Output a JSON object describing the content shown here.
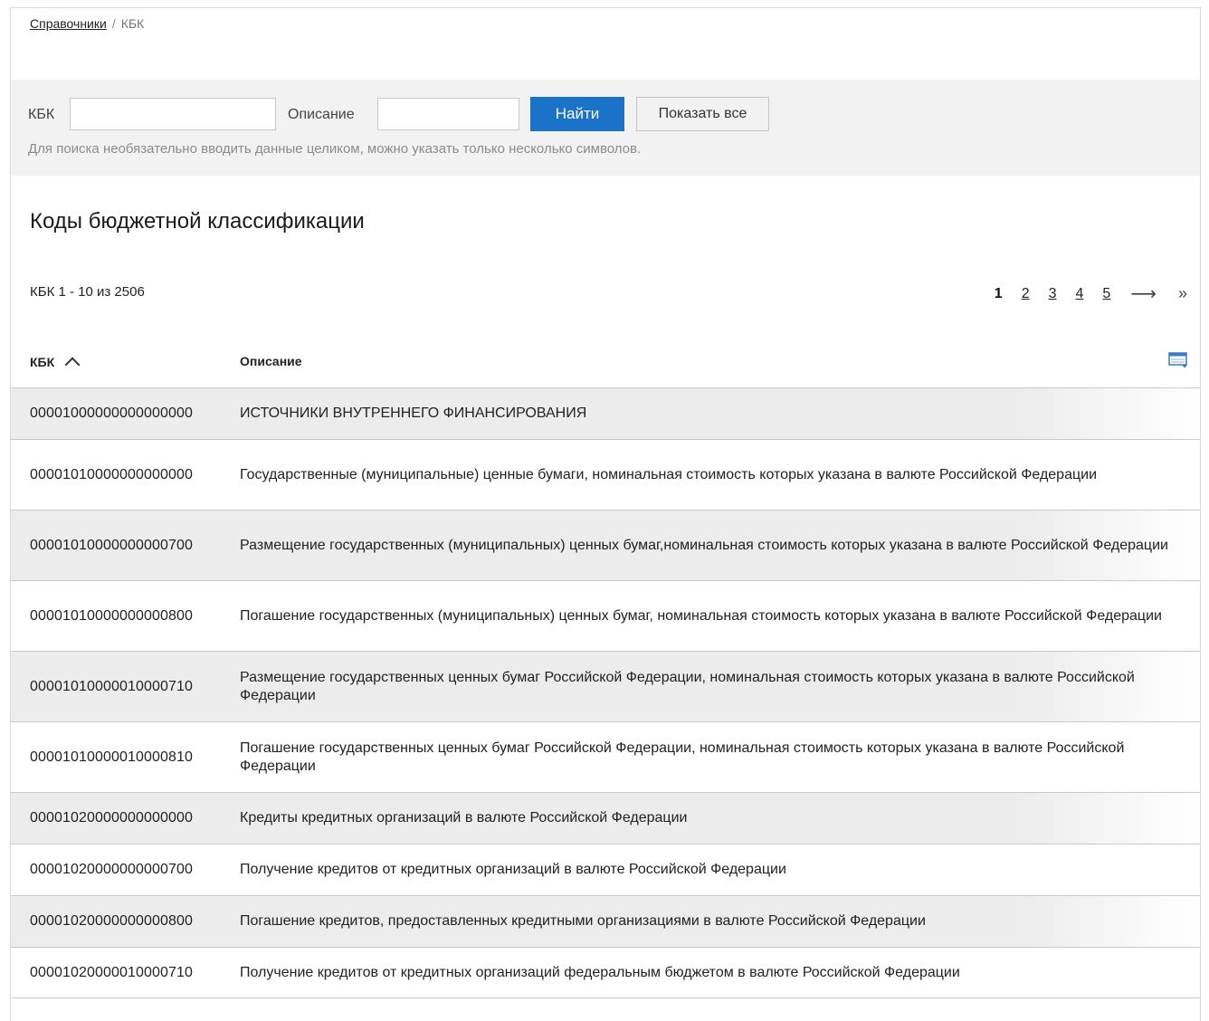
{
  "breadcrumb": {
    "parent": "Справочники",
    "separator": "/",
    "current": "КБК"
  },
  "search": {
    "kbk_label": "КБК",
    "kbk_value": "",
    "desc_label": "Описание",
    "desc_value": "",
    "find_button": "Найти",
    "show_all_button": "Показать все",
    "hint": "Для поиска необязательно вводить данные целиком, можно указать только несколько символов."
  },
  "title": "Коды бюджетной классификации",
  "summary": "КБК 1 - 10 из 2506",
  "pager": {
    "current": "1",
    "pages": [
      "2",
      "3",
      "4",
      "5"
    ],
    "next": "⟶",
    "last": "»"
  },
  "table": {
    "col_kbk": "КБК",
    "col_desc": "Описание",
    "rows": [
      {
        "kbk": "00001000000000000000",
        "desc": "ИСТОЧНИКИ ВНУТРЕННЕГО ФИНАНСИРОВАНИЯ"
      },
      {
        "kbk": "00001010000000000000",
        "desc": "Государственные (муниципальные) ценные бумаги, номинальная стоимость которых указана в валюте Российской Федерации"
      },
      {
        "kbk": "00001010000000000700",
        "desc": "Размещение государственных (муниципальных) ценных бумаг,номинальная стоимость которых указана в валюте Российской Федерации"
      },
      {
        "kbk": "00001010000000000800",
        "desc": "Погашение государственных (муниципальных) ценных бумаг, номинальная стоимость которых указана в валюте Российской Федерации"
      },
      {
        "kbk": "00001010000010000710",
        "desc": "Размещение государственных ценных бумаг Российской Федерации, номинальная стоимость которых указана в валюте Российской Федерации"
      },
      {
        "kbk": "00001010000010000810",
        "desc": "Погашение государственных ценных бумаг Российской Федерации, номинальная стоимость которых указана в валюте Российской Федерации"
      },
      {
        "kbk": "00001020000000000000",
        "desc": "Кредиты кредитных организаций в валюте Российской Федерации"
      },
      {
        "kbk": "00001020000000000700",
        "desc": "Получение кредитов от кредитных организаций в валюте Российской Федерации"
      },
      {
        "kbk": "00001020000000000800",
        "desc": "Погашение кредитов, предоставленных кредитными организациями в валюте Российской Федерации"
      },
      {
        "kbk": "00001020000010000710",
        "desc": "Получение кредитов от кредитных организаций федеральным бюджетом в валюте Российской Федерации"
      }
    ]
  },
  "colors": {
    "primary_button": "#1a73c9",
    "panel_bg": "#f2f2f2",
    "row_shade": "#ececec"
  }
}
